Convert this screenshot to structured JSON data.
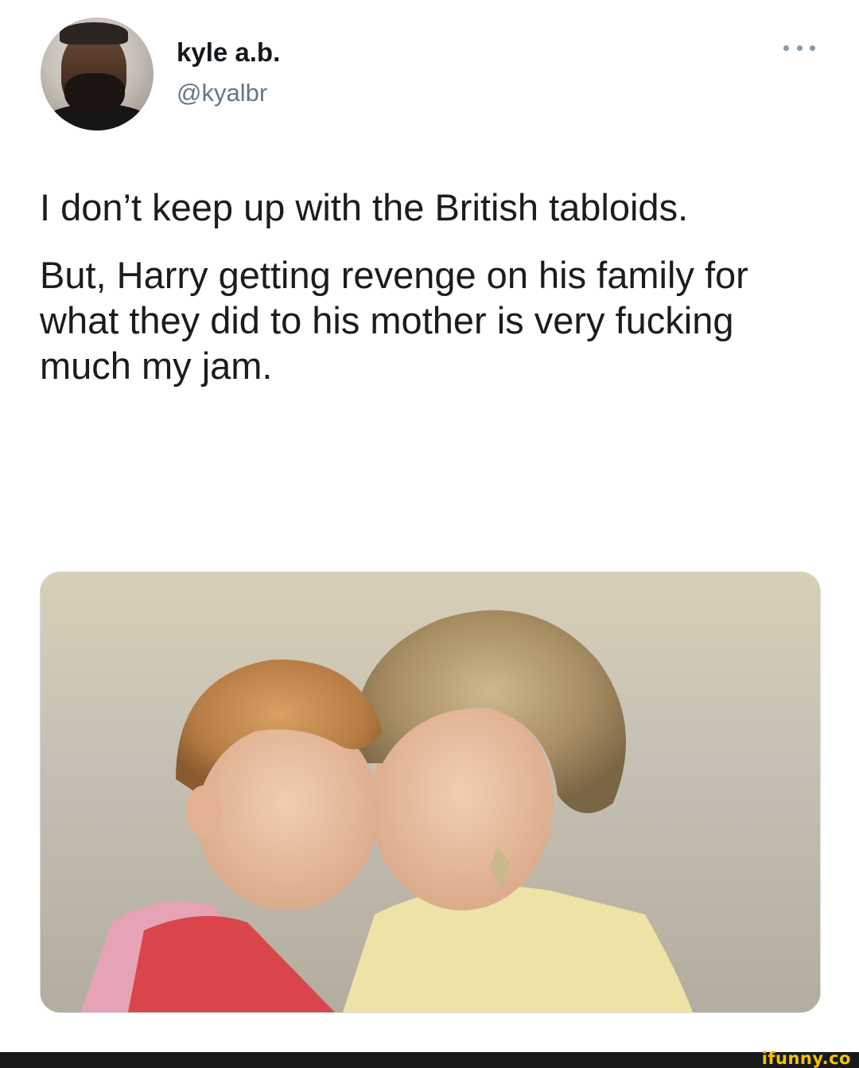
{
  "tweet": {
    "display_name": "kyle a.b.",
    "handle": "@kyalbr",
    "more_icon": "more-horizontal-icon",
    "text": [
      "I don’t keep up with the British tabloids.",
      "But, Harry getting revenge on his family for what they did to his mother is very fucking much my jam."
    ]
  },
  "media": {
    "description_icon": "photo"
  },
  "footer": {
    "watermark": "ifunny.co"
  },
  "colors": {
    "background": "#ffffff",
    "text": "#14171a",
    "secondary_text": "#657786",
    "watermark": "#f2c500",
    "footer_bar": "#1a1a1a"
  }
}
